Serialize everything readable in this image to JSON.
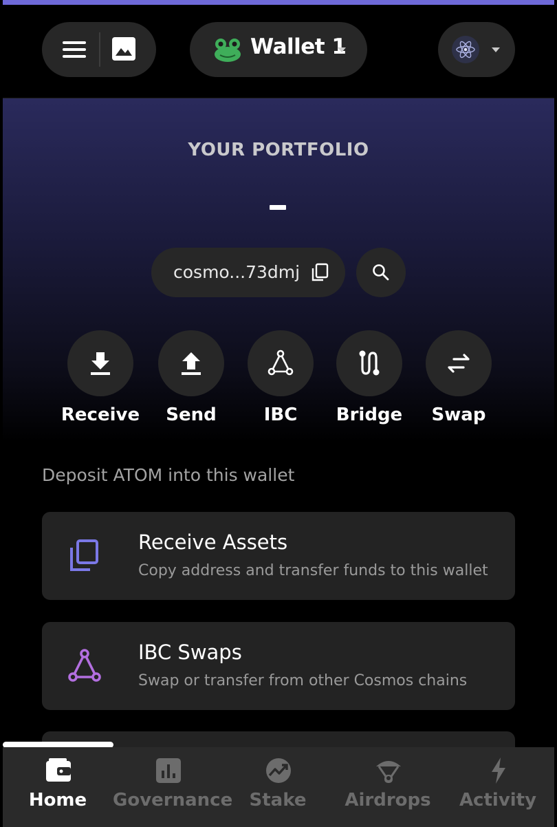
{
  "header": {
    "wallet_name": "Wallet 1",
    "accent_color": "#6e69d8"
  },
  "portfolio": {
    "label": "YOUR PORTFOLIO",
    "address_short": "cosmo...73dmj"
  },
  "actions": [
    {
      "label": "Receive",
      "icon": "download-icon"
    },
    {
      "label": "Send",
      "icon": "upload-icon"
    },
    {
      "label": "IBC",
      "icon": "ibc-triangle-icon"
    },
    {
      "label": "Bridge",
      "icon": "bridge-icon"
    },
    {
      "label": "Swap",
      "icon": "swap-arrows-icon"
    }
  ],
  "deposit": {
    "title": "Deposit ATOM into this wallet",
    "cards": [
      {
        "title": "Receive Assets",
        "subtitle": "Copy address and transfer funds to this wallet",
        "icon": "copy-icon",
        "icon_color": "#7b78e6"
      },
      {
        "title": "IBC Swaps",
        "subtitle": "Swap or transfer from other Cosmos chains",
        "icon": "ibc-triangle-icon",
        "icon_color": "#b36fe0"
      }
    ]
  },
  "tabs": [
    {
      "label": "Home",
      "icon": "wallet-icon",
      "active": true
    },
    {
      "label": "Governance",
      "icon": "bar-chart-icon",
      "active": false
    },
    {
      "label": "Stake",
      "icon": "stake-trend-icon",
      "active": false
    },
    {
      "label": "Airdrops",
      "icon": "parachute-icon",
      "active": false
    },
    {
      "label": "Activity",
      "icon": "lightning-icon",
      "active": false
    }
  ]
}
